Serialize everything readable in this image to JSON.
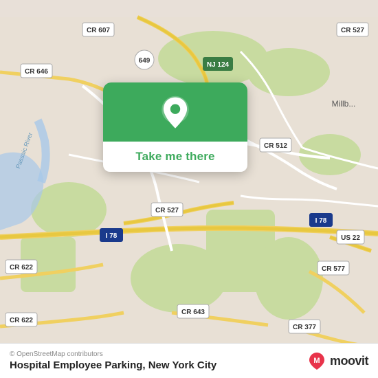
{
  "map": {
    "background_color": "#e8e0d8"
  },
  "location_card": {
    "button_label": "Take me there",
    "pin_icon": "location-pin"
  },
  "bottom_bar": {
    "attribution": "© OpenStreetMap contributors",
    "location_name": "Hospital Employee Parking, New York City",
    "moovit_label": "moovit"
  }
}
